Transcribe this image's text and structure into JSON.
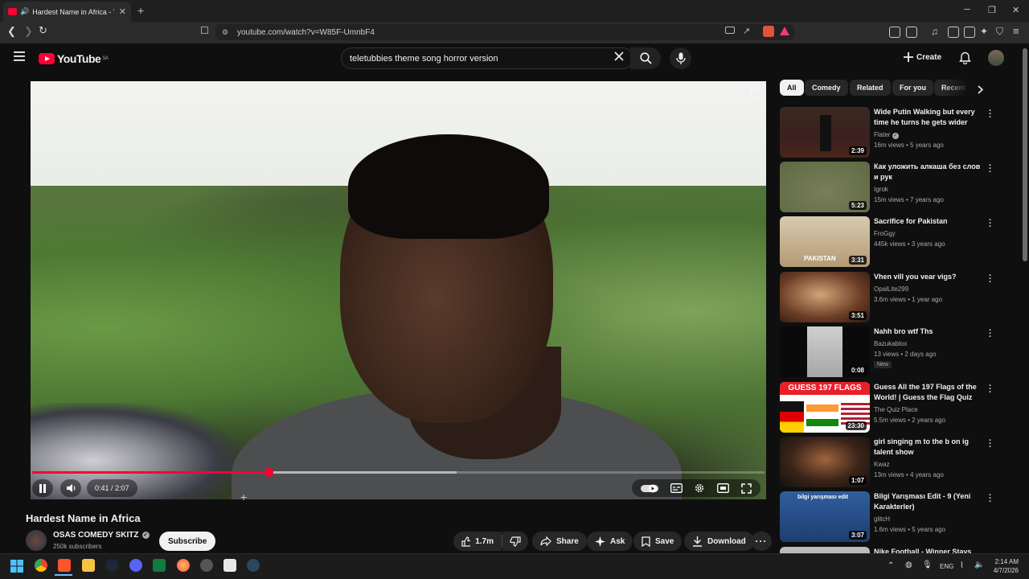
{
  "browser": {
    "tab_title": "Hardest Name in Africa - You",
    "url": "youtube.com/watch?v=W85F-UmnbF4",
    "new_tab_symbol": "+",
    "close_symbol": "✕"
  },
  "youtube": {
    "logo_text": "YouTube",
    "region": "SA",
    "search_query": "teletubbies theme song horror version",
    "create_label": "Create"
  },
  "player": {
    "current_time": "0:41",
    "duration": "2:07",
    "time_display": "0:41 / 2:07",
    "progress_fraction": 0.323,
    "buffered_fraction": 0.58
  },
  "video": {
    "title": "Hardest Name in Africa",
    "channel": "OSAS COMEDY SKITZ",
    "subscribers": "250k subscribers",
    "subscribe_label": "Subscribe",
    "likes": "1.7m",
    "share_label": "Share",
    "ask_label": "Ask",
    "save_label": "Save",
    "download_label": "Download"
  },
  "chips": [
    "All",
    "Comedy",
    "Related",
    "For you",
    "Recent"
  ],
  "recommendations": [
    {
      "title": "Wide Putin Walking but every time he turns he gets wider",
      "channel": "Flater",
      "verified": true,
      "meta": "16m views • 5 years ago",
      "duration": "2:39",
      "badge": ""
    },
    {
      "title": "Как уложить алкаша без слов и рук",
      "channel": "Igrok",
      "verified": false,
      "meta": "15m views • 7 years ago",
      "duration": "5:23",
      "badge": ""
    },
    {
      "title": "Sacrifice for Pakistan",
      "channel": "FroGgy",
      "verified": false,
      "meta": "445k views • 3 years ago",
      "duration": "3:31",
      "badge": ""
    },
    {
      "title": "Vhen vill you vear vigs?",
      "channel": "OpalLite299",
      "verified": false,
      "meta": "3.6m views • 1 year ago",
      "duration": "3:51",
      "badge": ""
    },
    {
      "title": "Nahh bro wtf Ths",
      "channel": "Bazukablox",
      "verified": false,
      "meta": "13 views • 2 days ago",
      "duration": "0:08",
      "badge": "New"
    },
    {
      "title": "Guess All the 197 Flags of the World! | Guess the Flag Quiz",
      "channel": "The Quiz Place",
      "verified": false,
      "meta": "5.5m views • 2 years ago",
      "duration": "23:30",
      "badge": ""
    },
    {
      "title": "girl singing m to the b on ig talent show",
      "channel": "Kwaz",
      "verified": false,
      "meta": "13m views • 4 years ago",
      "duration": "1:07",
      "badge": ""
    },
    {
      "title": "Bilgi Yarışması Edit - 9 (Yeni Karakterler)",
      "channel": "glitcH",
      "verified": false,
      "meta": "1.6m views • 5 years ago",
      "duration": "3:07",
      "badge": ""
    },
    {
      "title": "Nike Football - Winner Stays",
      "channel": "",
      "verified": false,
      "meta": "",
      "duration": "",
      "badge": ""
    }
  ],
  "thumb_text": {
    "flags_banner": "GUESS 197 FLAGS",
    "pakistan_caption": "PAKISTAN",
    "bilgi_caption": "bilgi yarışması edit"
  },
  "taskbar": {
    "lang": "ENG",
    "time": "2:14 AM",
    "date": "4/7/2026"
  },
  "colors": {
    "accent_red": "#ff0033",
    "background": "#0f0f0f",
    "chip_bg": "#272727"
  },
  "icons": [
    "menu-icon",
    "search-icon",
    "mic-icon",
    "bell-icon",
    "pause-icon",
    "volume-icon",
    "autoplay-toggle-icon",
    "subtitles-icon",
    "settings-icon",
    "miniplayer-icon",
    "fullscreen-icon",
    "like-icon",
    "dislike-icon",
    "share-icon",
    "sparkle-icon",
    "save-icon",
    "download-icon",
    "more-icon"
  ]
}
